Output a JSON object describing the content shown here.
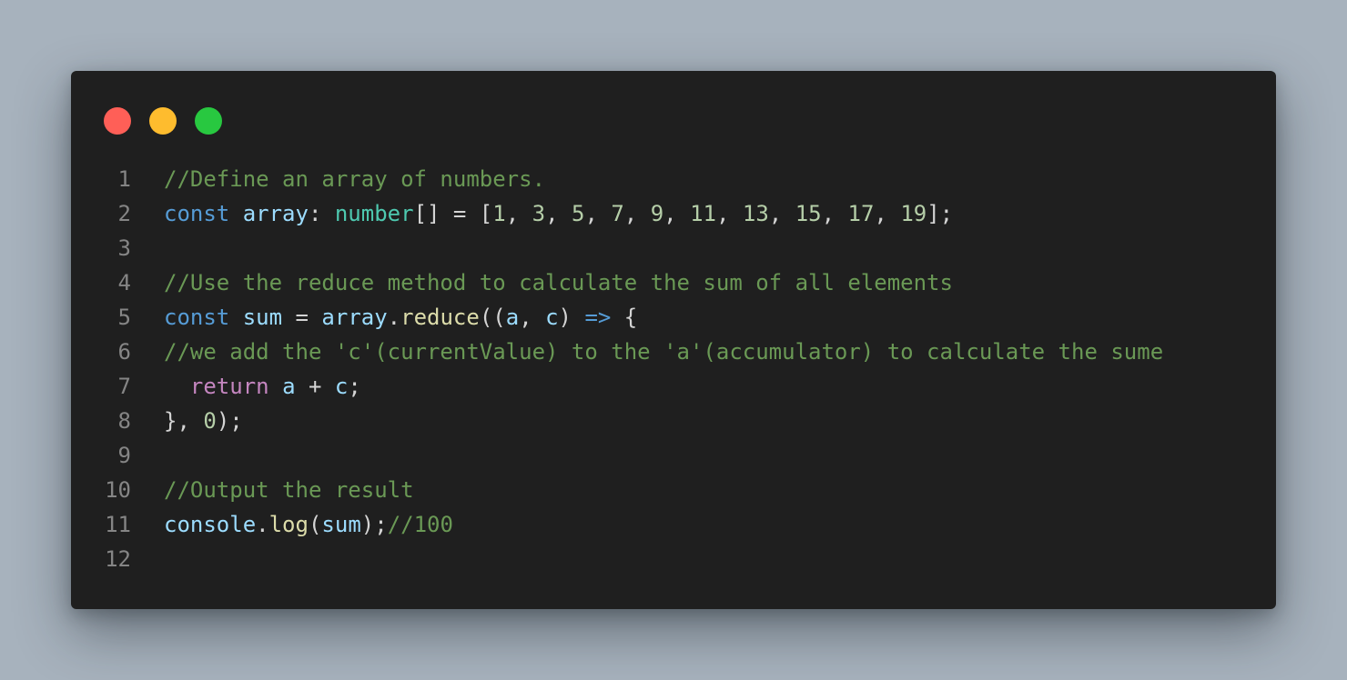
{
  "window": {
    "buttons": [
      {
        "name": "close",
        "color": "#ff5f57"
      },
      {
        "name": "minimize",
        "color": "#febc2e"
      },
      {
        "name": "maximize",
        "color": "#28c840"
      }
    ]
  },
  "colors": {
    "background": "#a7b2bd",
    "editor_bg": "#1f1f1f",
    "comment": "#6a9955",
    "keyword": "#569cd6",
    "control": "#c586c0",
    "variable": "#9cdcfe",
    "type": "#4ec9b0",
    "function": "#dcdcaa",
    "number": "#b5cea8",
    "punctuation": "#d4d4d4",
    "line_number": "#858585"
  },
  "code": {
    "lines": [
      {
        "n": "1",
        "tokens": [
          {
            "t": "//Define an array of numbers.",
            "c": "comment"
          }
        ]
      },
      {
        "n": "2",
        "tokens": [
          {
            "t": "const",
            "c": "keyword"
          },
          {
            "t": " ",
            "c": "punct"
          },
          {
            "t": "array",
            "c": "variable"
          },
          {
            "t": ": ",
            "c": "punct"
          },
          {
            "t": "number",
            "c": "type"
          },
          {
            "t": "[] = [",
            "c": "punct"
          },
          {
            "t": "1",
            "c": "number"
          },
          {
            "t": ", ",
            "c": "punct"
          },
          {
            "t": "3",
            "c": "number"
          },
          {
            "t": ", ",
            "c": "punct"
          },
          {
            "t": "5",
            "c": "number"
          },
          {
            "t": ", ",
            "c": "punct"
          },
          {
            "t": "7",
            "c": "number"
          },
          {
            "t": ", ",
            "c": "punct"
          },
          {
            "t": "9",
            "c": "number"
          },
          {
            "t": ", ",
            "c": "punct"
          },
          {
            "t": "11",
            "c": "number"
          },
          {
            "t": ", ",
            "c": "punct"
          },
          {
            "t": "13",
            "c": "number"
          },
          {
            "t": ", ",
            "c": "punct"
          },
          {
            "t": "15",
            "c": "number"
          },
          {
            "t": ", ",
            "c": "punct"
          },
          {
            "t": "17",
            "c": "number"
          },
          {
            "t": ", ",
            "c": "punct"
          },
          {
            "t": "19",
            "c": "number"
          },
          {
            "t": "];",
            "c": "punct"
          }
        ]
      },
      {
        "n": "3",
        "tokens": []
      },
      {
        "n": "4",
        "tokens": [
          {
            "t": "//Use the reduce method to calculate the sum of all elements",
            "c": "comment"
          }
        ]
      },
      {
        "n": "5",
        "tokens": [
          {
            "t": "const",
            "c": "keyword"
          },
          {
            "t": " ",
            "c": "punct"
          },
          {
            "t": "sum",
            "c": "variable"
          },
          {
            "t": " = ",
            "c": "punct"
          },
          {
            "t": "array",
            "c": "variable"
          },
          {
            "t": ".",
            "c": "punct"
          },
          {
            "t": "reduce",
            "c": "func"
          },
          {
            "t": "((",
            "c": "punct"
          },
          {
            "t": "a",
            "c": "variable"
          },
          {
            "t": ", ",
            "c": "punct"
          },
          {
            "t": "c",
            "c": "variable"
          },
          {
            "t": ") ",
            "c": "punct"
          },
          {
            "t": "=>",
            "c": "keyword"
          },
          {
            "t": " {",
            "c": "punct"
          }
        ]
      },
      {
        "n": "6",
        "tokens": [
          {
            "t": "//we add the 'c'(currentValue) to the 'a'(accumulator) to calculate the sume",
            "c": "comment"
          }
        ]
      },
      {
        "n": "7",
        "tokens": [
          {
            "t": "  ",
            "c": "punct"
          },
          {
            "t": "return",
            "c": "control"
          },
          {
            "t": " ",
            "c": "punct"
          },
          {
            "t": "a",
            "c": "variable"
          },
          {
            "t": " + ",
            "c": "punct"
          },
          {
            "t": "c",
            "c": "variable"
          },
          {
            "t": ";",
            "c": "punct"
          }
        ]
      },
      {
        "n": "8",
        "tokens": [
          {
            "t": "}, ",
            "c": "punct"
          },
          {
            "t": "0",
            "c": "number"
          },
          {
            "t": ");",
            "c": "punct"
          }
        ]
      },
      {
        "n": "9",
        "tokens": []
      },
      {
        "n": "10",
        "tokens": [
          {
            "t": "//Output the result",
            "c": "comment"
          }
        ]
      },
      {
        "n": "11",
        "tokens": [
          {
            "t": "console",
            "c": "variable"
          },
          {
            "t": ".",
            "c": "punct"
          },
          {
            "t": "log",
            "c": "func"
          },
          {
            "t": "(",
            "c": "punct"
          },
          {
            "t": "sum",
            "c": "variable"
          },
          {
            "t": ");",
            "c": "punct"
          },
          {
            "t": "//100",
            "c": "comment"
          }
        ]
      },
      {
        "n": "12",
        "tokens": []
      }
    ]
  }
}
